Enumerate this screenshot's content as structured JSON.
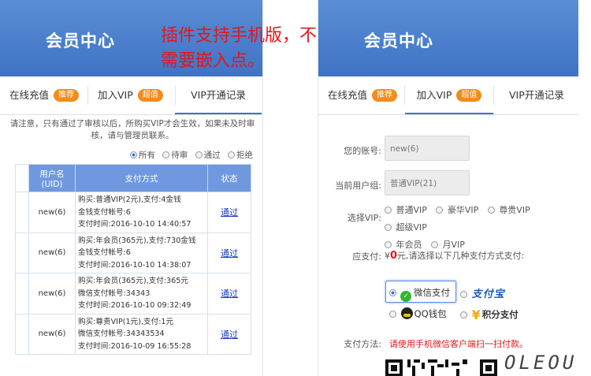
{
  "overlay_text": [
    "插件支持手机版，不",
    "需要嵌入点。"
  ],
  "left": {
    "header_title": "会员中心",
    "tabs": [
      {
        "label": "在线充值",
        "badge": "推荐"
      },
      {
        "label": "加入VIP",
        "badge": "超值"
      },
      {
        "label": "VIP开通记录",
        "badge": ""
      }
    ],
    "notice": "请注意，只有通过了审核以后，所购买VIP才会生效，如果未及时审核，请与管理员联系。",
    "filters": [
      "所有",
      "待审",
      "通过",
      "拒绝"
    ],
    "table": {
      "headers": [
        "用户名 (UID)",
        "支付方式",
        "状态"
      ],
      "rows": [
        {
          "uid": "new(6)",
          "lines": [
            "购买:普通VIP(2元),支付:4金钱",
            "金钱支付帐号:6",
            "支付时间:2016-10-10 14:40:57"
          ],
          "status": "通过"
        },
        {
          "uid": "new(6)",
          "lines": [
            "购买:年会员(365元),支付:730金钱",
            "金钱支付帐号:6",
            "支付时间:2016-10-10 14:38:07"
          ],
          "status": "通过"
        },
        {
          "uid": "new(6)",
          "lines": [
            "购买:年会员(365元),支付:365元",
            "微信支付帐号:34343",
            "支付时间:2016-10-10 09:32:49"
          ],
          "status": "通过"
        },
        {
          "uid": "new(6)",
          "lines": [
            "购买:尊贵VIP(1元),支付:1元",
            "微信支付帐号:34343534",
            "支付时间:2016-10-09 16:55:28"
          ],
          "status": "通过"
        }
      ]
    }
  },
  "right": {
    "header_title": "会员中心",
    "tabs": [
      {
        "label": "在线充值",
        "badge": "推荐"
      },
      {
        "label": "加入VIP",
        "badge": "超值"
      },
      {
        "label": "VIP开通记录",
        "badge": ""
      }
    ],
    "account_label": "您的账号:",
    "account_value": "new(6)",
    "group_label": "当前用户组:",
    "group_value": "普通VIP(21)",
    "select_label": "选择VIP:",
    "vip_options": [
      "普通VIP",
      "豪华VIP",
      "尊贵VIP",
      "超级VIP",
      "年会员",
      "月VIP"
    ],
    "amount_label": "应支付:",
    "amount_prefix": "¥",
    "amount_value": "0",
    "amount_suffix": "元,请选择以下几种支付方式支付:",
    "pay_methods": [
      "微信支付",
      "支付宝",
      "QQ钱包",
      "积分支付"
    ],
    "method_label": "支付方法:",
    "method_text": "请使用手机微信客户端扫一扫付款。"
  },
  "watermark": "OLEOU"
}
